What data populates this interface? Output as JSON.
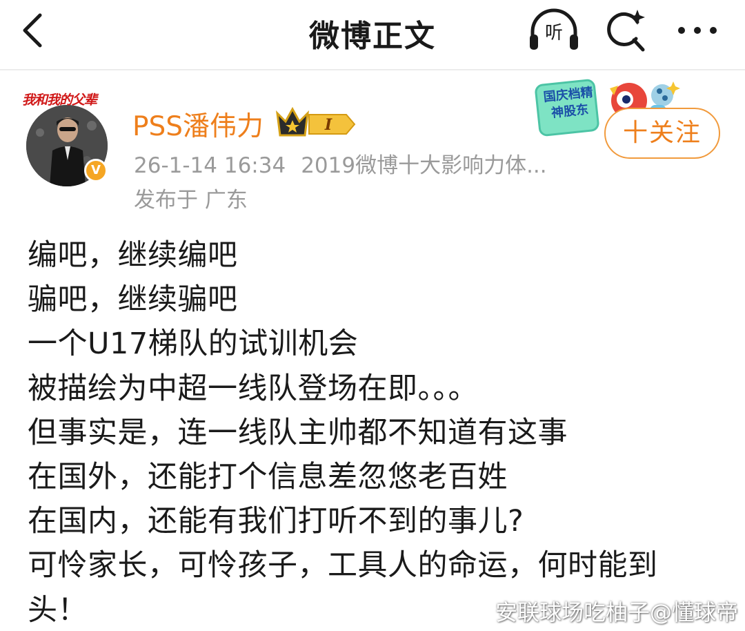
{
  "header": {
    "title": "微博正文",
    "listen_label": "听",
    "back_icon": "back-arrow-icon",
    "search_icon": "search-sparkle-icon",
    "more_icon": "more-dots-icon"
  },
  "author": {
    "name": "PSS潘伟力",
    "avatar_banner": "我和我的父辈",
    "verified_mark": "V",
    "member_level": "I",
    "timestamp": "26-1-14 16:34",
    "source": "2019微博十大影响力体...",
    "location": "发布于 广东",
    "follow_label": "十关注",
    "promo_sticker": "国庆档精神股东"
  },
  "post": {
    "lines": [
      "编吧，继续编吧",
      "骗吧，继续骗吧",
      "一个U17梯队的试训机会",
      "被描绘为中超一线队登场在即。。。",
      "但事实是，连一线队主帅都不知道有这事",
      "在国外，还能打个信息差忽悠老百姓",
      "在国内，还能有我们打听不到的事儿?",
      "可怜家长，可怜孩子，工具人的命运，何时能到",
      "头！"
    ]
  },
  "watermark": "安联球场吃柚子@懂球帝",
  "colors": {
    "accent_orange": "#ee7f1c",
    "meta_gray": "#9a9a9a",
    "text": "#1a1a1a",
    "follow_border": "#f19a3c",
    "badge_gold": "#f5a623"
  }
}
